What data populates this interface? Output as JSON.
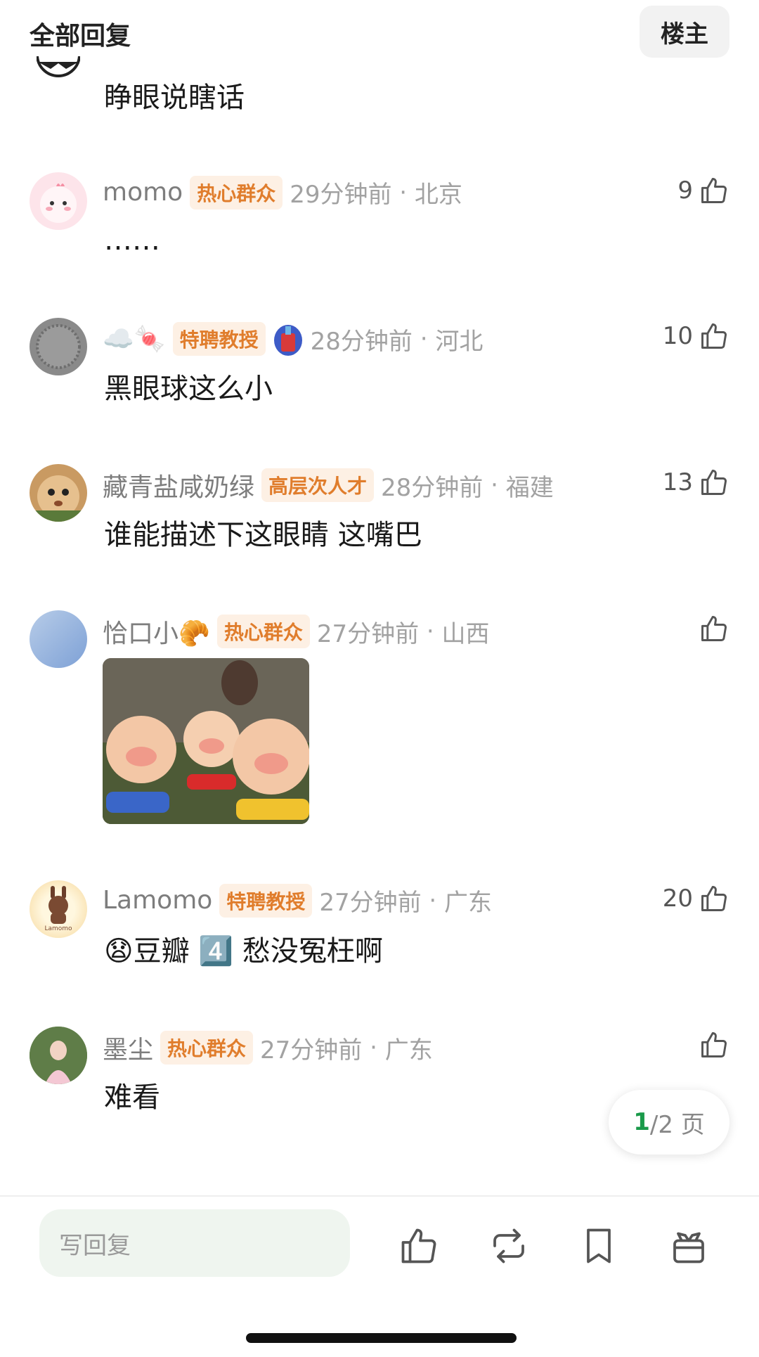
{
  "header": {
    "title": "全部回复",
    "op_label": "楼主"
  },
  "comments": [
    {
      "body": "睁眼说瞎话"
    },
    {
      "name": "momo",
      "badge": "热心群众",
      "time": "29分钟前",
      "location": "北京",
      "likes": "9",
      "body": "……"
    },
    {
      "name": "☁️🍬",
      "badge": "特聘教授",
      "time": "28分钟前",
      "location": "河北",
      "likes": "10",
      "body": "黑眼球这么小"
    },
    {
      "name": "藏青盐咸奶绿",
      "badge": "高层次人才",
      "time": "28分钟前",
      "location": "福建",
      "likes": "13",
      "body": "谁能描述下这眼睛 这嘴巴"
    },
    {
      "name": "恰口小🥐",
      "badge": "热心群众",
      "time": "27分钟前",
      "location": "山西",
      "likes": "",
      "body": ""
    },
    {
      "name": "Lamomo",
      "badge": "特聘教授",
      "time": "27分钟前",
      "location": "广东",
      "likes": "20",
      "body": "😧豆瓣 4️⃣ 愁没冤枉啊",
      "avatar_text": "Lamomo"
    },
    {
      "name": "墨尘",
      "badge": "热心群众",
      "time": "27分钟前",
      "location": "广东",
      "likes": "",
      "body": "难看"
    }
  ],
  "pager": {
    "current": "1",
    "total": "/2 页"
  },
  "bottom": {
    "reply_placeholder": "写回复"
  },
  "colors": {
    "badge_text": "#e07d2c",
    "badge_bg": "#fdf0e4",
    "pager_current": "#1a9a4a",
    "meta": "#a2a2a2"
  },
  "icons": [
    "thumbs-up-icon",
    "repost-icon",
    "bookmark-icon",
    "gift-icon"
  ]
}
